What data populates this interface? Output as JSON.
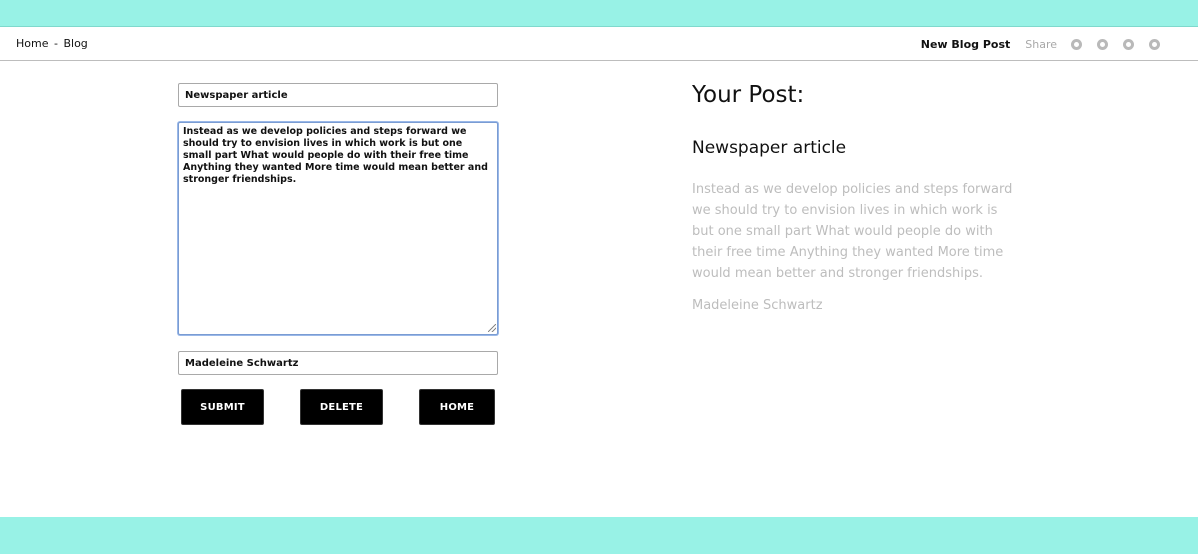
{
  "header": {
    "breadcrumb_home": "Home",
    "breadcrumb_sep": "-",
    "breadcrumb_blog": "Blog",
    "page_title": "New Blog Post",
    "share_label": "Share",
    "social_icons": [
      "twitter-icon",
      "facebook-icon",
      "google-plus-icon",
      "pinterest-icon"
    ]
  },
  "form": {
    "title_value": "Newspaper article",
    "body_value": "Instead as we develop policies and steps forward we should try to envision lives in which work is but one small part What would people do with their free time Anything they wanted More time would mean better and stronger friendships.",
    "author_value": "Madeleine Schwartz",
    "submit_label": "SUBMIT",
    "delete_label": "DELETE",
    "home_label": "HOME"
  },
  "preview": {
    "heading": "Your Post:",
    "title": "Newspaper article",
    "body": "Instead as we develop policies and steps forward we should try to envision lives in which work is but one small part What would people do with their free time Anything they wanted More time would mean better and stronger friendships.",
    "author": "Madeleine Schwartz"
  },
  "colors": {
    "accent_teal": "#98f2e6",
    "button_bg": "#000000",
    "muted_text": "#bdbdbd"
  }
}
